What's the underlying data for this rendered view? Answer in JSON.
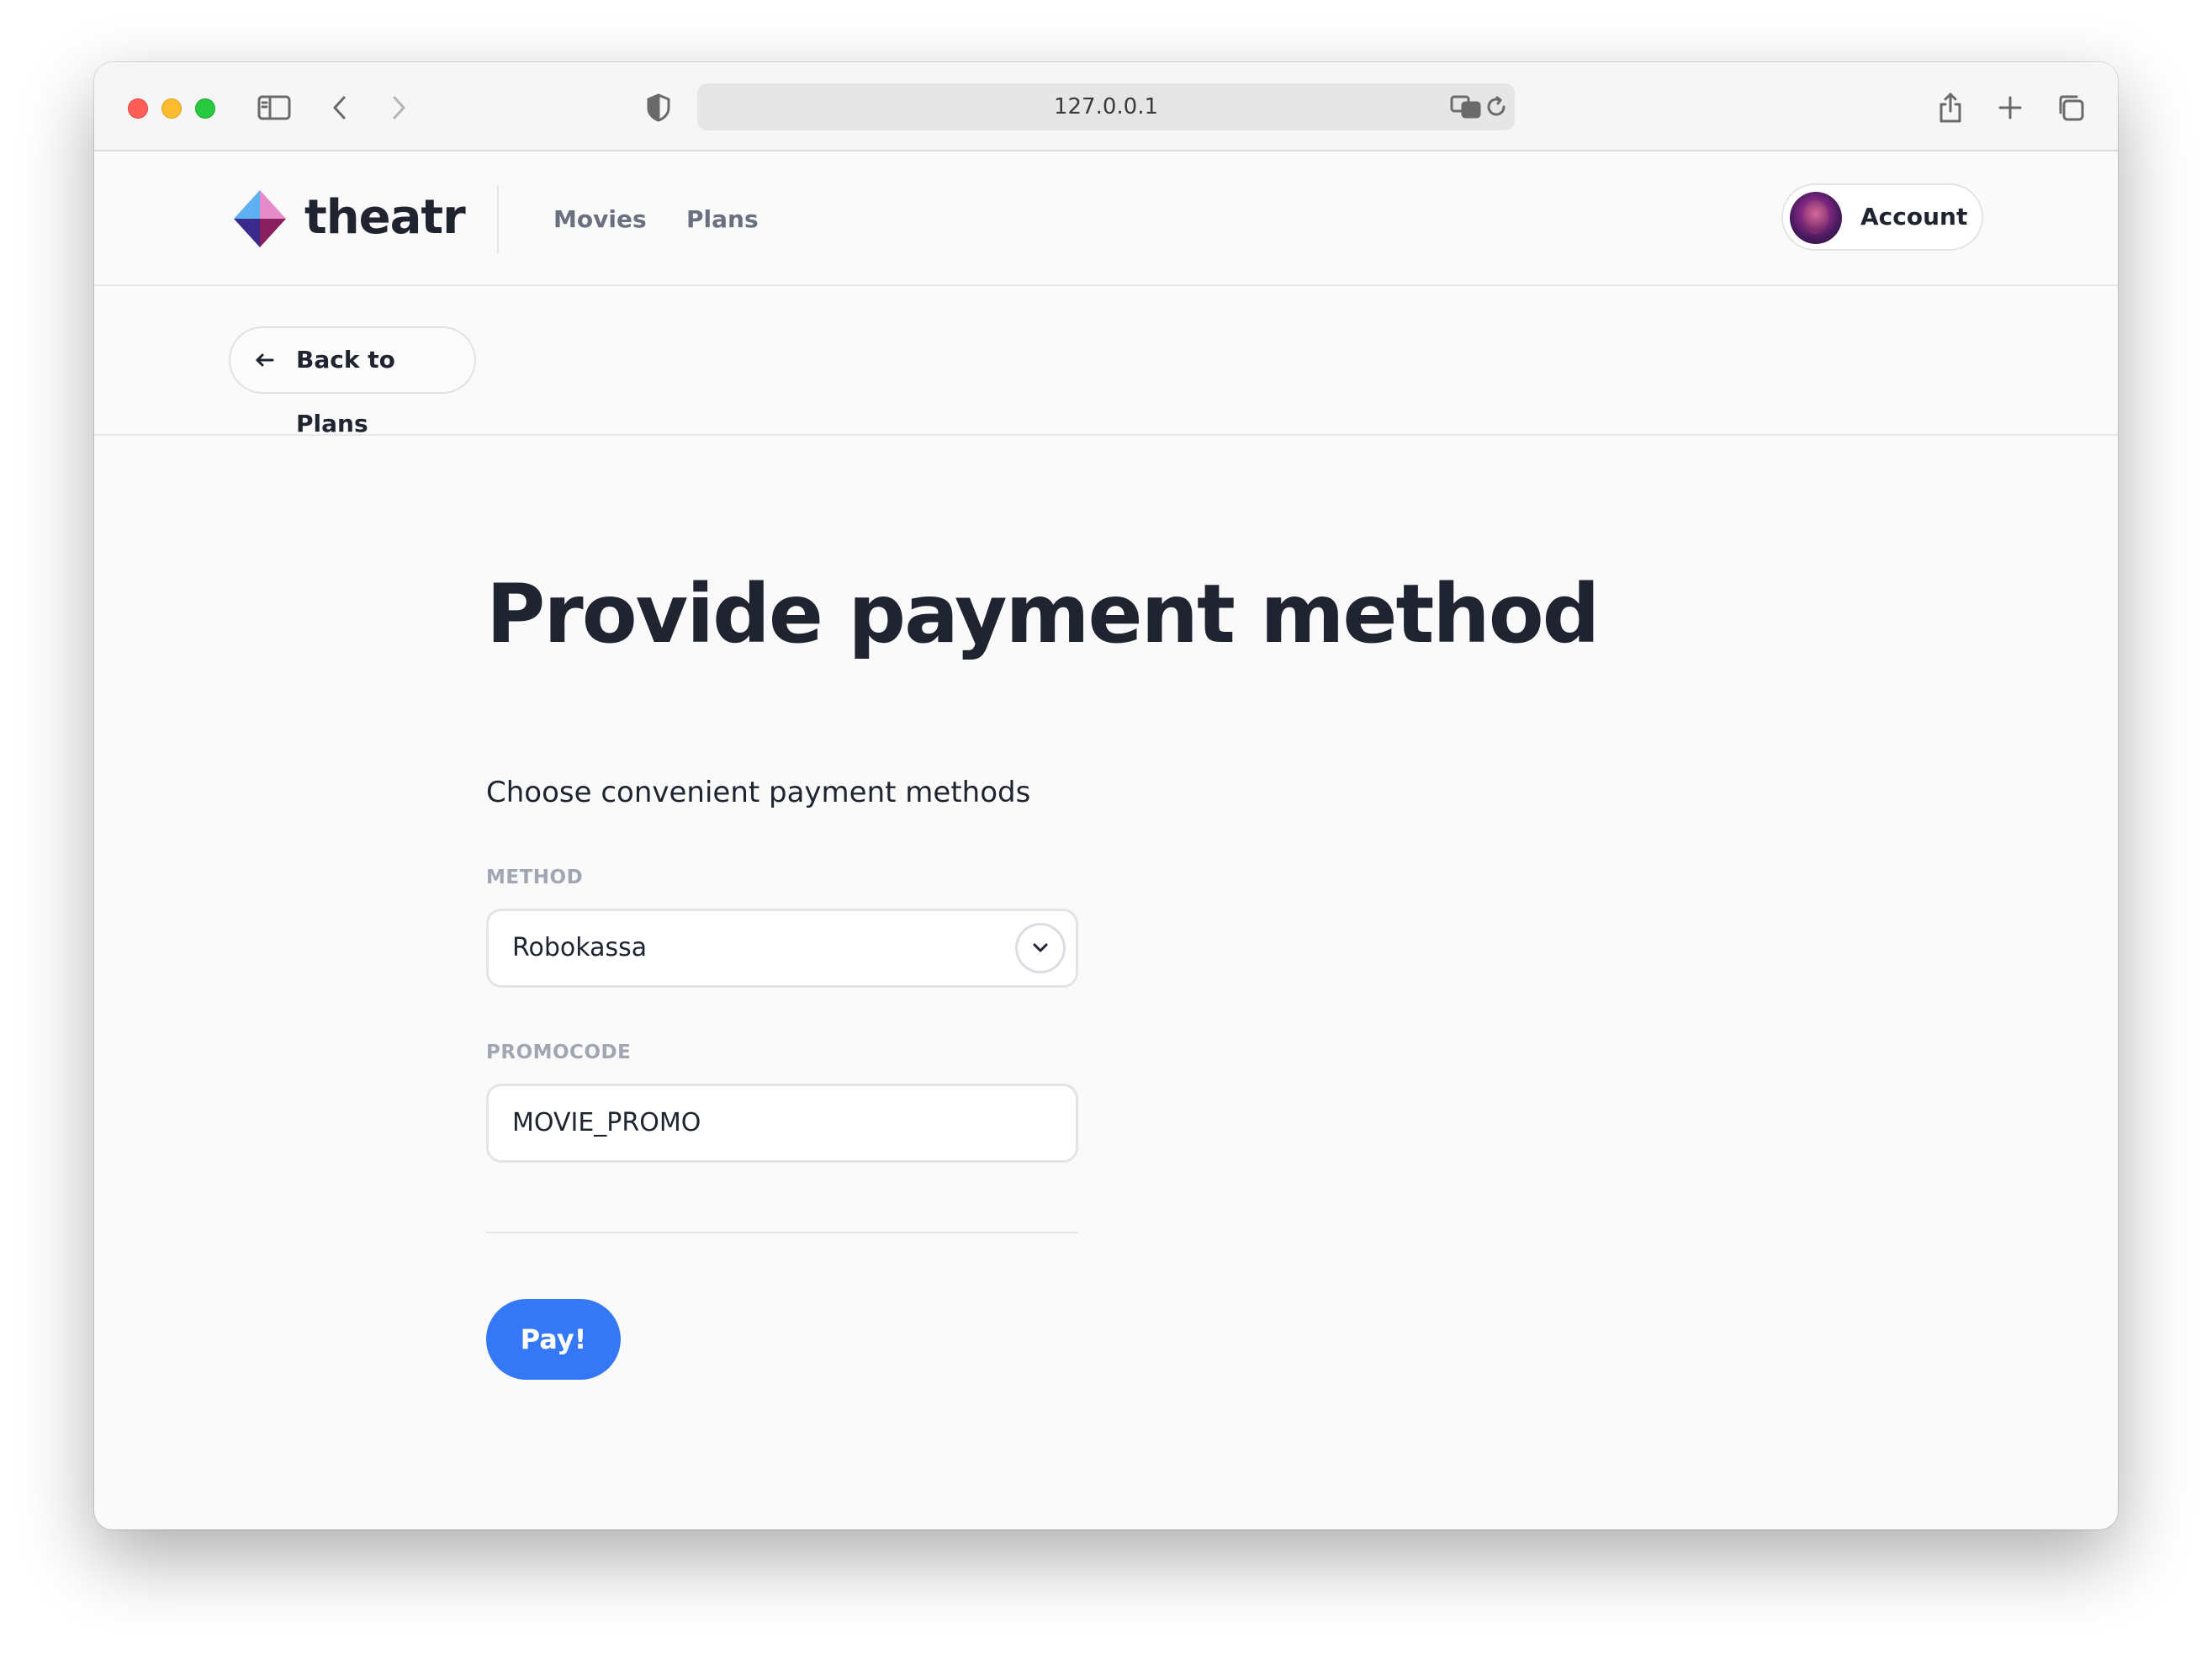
{
  "browser": {
    "url": "127.0.0.1"
  },
  "site": {
    "brand": "theatr",
    "nav": [
      {
        "label": "Movies"
      },
      {
        "label": "Plans"
      }
    ],
    "account_label": "Account"
  },
  "back_button": {
    "label": "Back to Plans"
  },
  "form": {
    "title": "Provide payment method",
    "subtitle": "Choose convenient payment methods",
    "method_label": "METHOD",
    "method_value": "Robokassa",
    "promocode_label": "PROMOCODE",
    "promocode_value": "MOVIE_PROMO",
    "submit_label": "Pay!"
  },
  "colors": {
    "accent": "#3478f6",
    "text": "#1f2430",
    "muted": "#a2a6b3"
  },
  "icons": [
    "sidebar-toggle-icon",
    "back-icon",
    "forward-icon",
    "shield-icon",
    "translate-icon",
    "reload-icon",
    "share-icon",
    "new-tab-icon",
    "tabs-overview-icon",
    "theatr-logo-icon",
    "arrow-left-icon",
    "chevron-down-icon"
  ]
}
